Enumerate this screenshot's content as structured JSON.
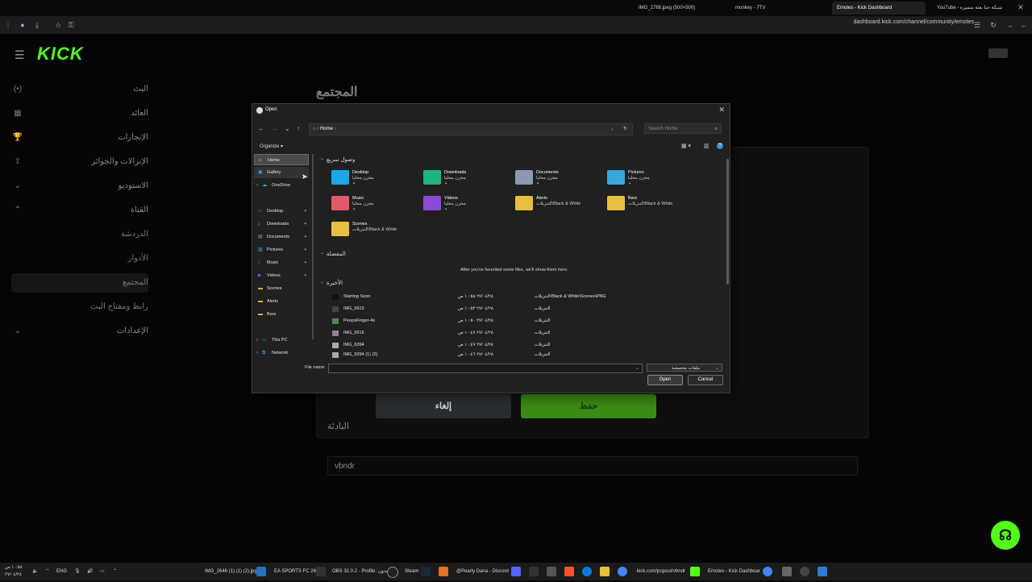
{
  "browser": {
    "tabs": [
      {
        "label": "IMG_2768.jpeg (500×500)"
      },
      {
        "label": "monkey - 7TV"
      },
      {
        "label": "Emotes - Kick Dashboard"
      },
      {
        "label": "YouTube - شبكة حنا بعثة متميزة"
      }
    ],
    "url": "dashboard.kick.com/channel/community/emotes"
  },
  "page": {
    "logo": "KICK",
    "nav": [
      {
        "label": "البث",
        "icon": "(•)"
      },
      {
        "label": "العائد",
        "icon": "▦"
      },
      {
        "label": "الإنجازات",
        "icon": "🏆"
      },
      {
        "label": "الإنزالات والجوائز",
        "icon": "⇪"
      },
      {
        "label": "الاستوديو",
        "icon": "⌄"
      },
      {
        "label": "القناة",
        "icon": "⌃"
      },
      {
        "label": "الدردشة",
        "icon": ""
      },
      {
        "label": "الأدوار",
        "icon": ""
      },
      {
        "label": "المجتمع",
        "icon": ""
      },
      {
        "label": "رابط ومفتاح البث",
        "icon": ""
      },
      {
        "label": "الإعدادات",
        "icon": "⌄"
      }
    ],
    "title": "المجتمع",
    "cancel_label": "إلغاء",
    "save_label": "حفظ",
    "prefix_label": "البادئة",
    "prefix_value": "vbndr"
  },
  "dialog": {
    "title": "Open",
    "address": "Home",
    "search_placeholder": "Search Home",
    "organize": "Organize",
    "left_pane": [
      {
        "label": "Home",
        "glyph": "⌂"
      },
      {
        "label": "Gallery",
        "glyph": "▣"
      },
      {
        "label": "OneDrive",
        "glyph": "☁"
      },
      {
        "label": "Desktop",
        "glyph": "▭"
      },
      {
        "label": "Downloads",
        "glyph": "⤓"
      },
      {
        "label": "Documents",
        "glyph": "▤"
      },
      {
        "label": "Pictures",
        "glyph": "▨"
      },
      {
        "label": "Music",
        "glyph": "♪"
      },
      {
        "label": "Videos",
        "glyph": "▶"
      },
      {
        "label": "Scenes",
        "glyph": "▬"
      },
      {
        "label": "Alerts",
        "glyph": "▬"
      },
      {
        "label": "Bars",
        "glyph": "▬"
      },
      {
        "label": "This PC",
        "glyph": "▭"
      },
      {
        "label": "Network",
        "glyph": "⧉"
      }
    ],
    "quick_access_title": "وصول سريع",
    "quick_access": [
      {
        "name": "Desktop",
        "sub": "مخزن محليا",
        "color": "#1ca8e6"
      },
      {
        "name": "Downloads",
        "sub": "مخزن محليا",
        "color": "#1fb47a"
      },
      {
        "name": "Documents",
        "sub": "مخزن محليا",
        "color": "#8a98b0"
      },
      {
        "name": "Pictures",
        "sub": "مخزن محليا",
        "color": "#3aa6e0"
      },
      {
        "name": "Music",
        "sub": "مخزن محليا",
        "color": "#e05a6a"
      },
      {
        "name": "Videos",
        "sub": "مخزن محليا",
        "color": "#8a4ad6"
      },
      {
        "name": "Alerts",
        "sub": "التنزيلات\\Black & White",
        "color": "#e8c040"
      },
      {
        "name": "Bars",
        "sub": "التنزيلات\\Black & White",
        "color": "#e8c040"
      },
      {
        "name": "Scenes",
        "sub": "التنزيلات\\Black & White",
        "color": "#e8c040"
      }
    ],
    "favorites_title": "المفضلة",
    "favorites_empty": "After you've favorited some files, we'll show them here.",
    "recent_title": "الأخيرة",
    "recent": [
      {
        "name": "Starting Soon",
        "date": "٢٧/٠٤/٢٨ ١٠:٥٨ ص",
        "path": "التنزيلات\\Black & White\\Scenes\\PNG"
      },
      {
        "name": "IMG_6915",
        "date": "٢٧/٠٤/٢٨ ١٠:٥٣ ص",
        "path": "التنزيلات"
      },
      {
        "name": "PeepoFinger-4x",
        "date": "٢٧/٠٤/٢٨ ١٠:٥٠ ص",
        "path": "التنزيلات"
      },
      {
        "name": "IMG_6916",
        "date": "٢٧/٠٤/٢٨ ١٠:٤٧ ص",
        "path": "التنزيلات"
      },
      {
        "name": "IMG_6394",
        "date": "٢٧/٠٤/٢٨ ١٠:٤٧ ص",
        "path": "التنزيلات"
      },
      {
        "name": "IMG_6394 (1) (2)",
        "date": "٢٧/٠٤/٢٨ ١٠:٤٦ ص",
        "path": "التنزيلات"
      }
    ],
    "file_name_label": "File name:",
    "file_name_value": "",
    "file_type": "ملفات مخصصة",
    "open_label": "Open",
    "cancel_label": "Cancel"
  },
  "taskbar": {
    "clock_time": "١٠:٥٨ ص",
    "clock_date": "٢٧/٠٤/٢٨",
    "lang": "ENG",
    "apps": [
      {
        "label": "IMG_2646 (1) (1) (2).jpg"
      },
      {
        "label": "EA SPORTS FC 26"
      },
      {
        "label": "OBS 32.0.2 - Profile: بدون"
      },
      {
        "label": "Steam"
      },
      {
        "label": "@Pearly Dana - Discord"
      },
      {
        "label": "kick.com/popout/vbndr"
      },
      {
        "label": "Emotes - Kick Dashboar"
      }
    ]
  }
}
